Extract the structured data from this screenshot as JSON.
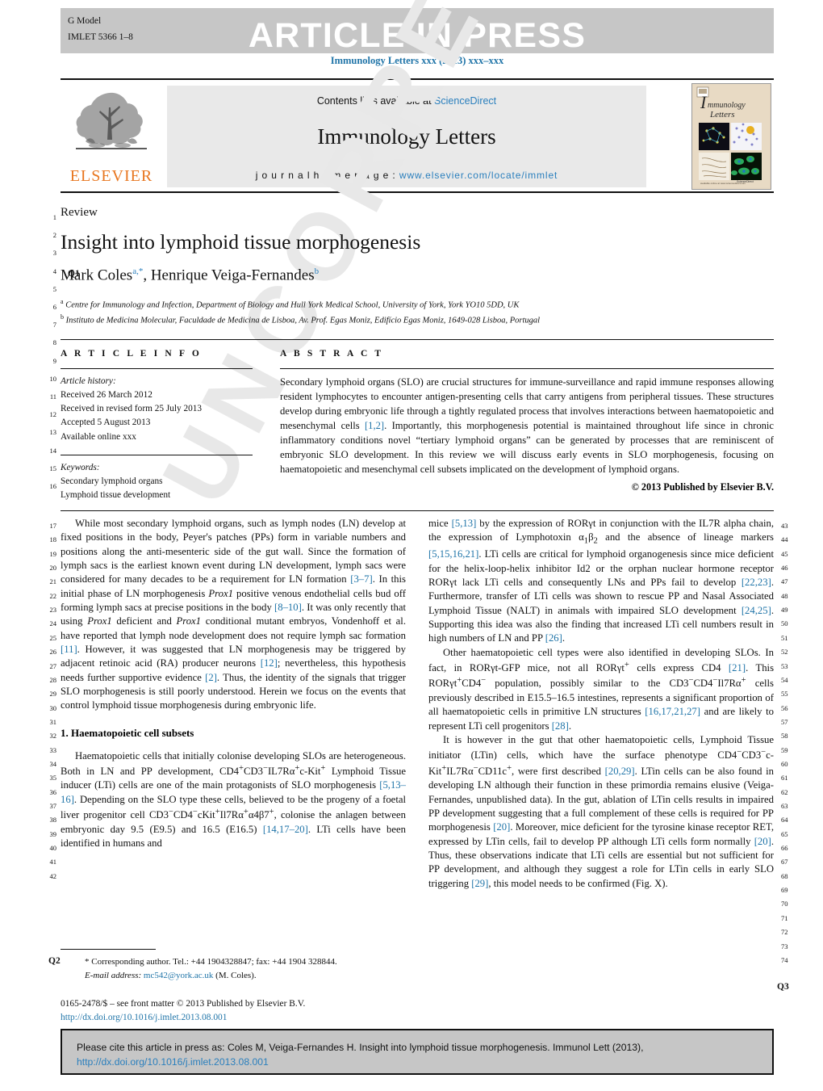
{
  "header": {
    "g_model_label": "G Model",
    "g_model_id": "IMLET 5366 1–8",
    "article_in_press": "ARTICLE IN PRESS",
    "journal_ref": "Immunology Letters xxx (2013) xxx–xxx"
  },
  "masthead": {
    "publisher": "ELSEVIER",
    "contents_prefix": "Contents lists available at ",
    "contents_link": "ScienceDirect",
    "journal_name": "Immunology Letters",
    "homepage_prefix": "j o u r n a l  h o m e p a g e :  ",
    "homepage_url": "www.elsevier.com/locate/immlet",
    "cover_title_line1": "Immunology",
    "cover_title_line2": "Letters"
  },
  "title_block": {
    "kicker": "Review",
    "title": "Insight into lymphoid tissue morphogenesis",
    "author1": "Mark Coles",
    "author1_sup": "a,*",
    "author_sep": ", ",
    "author2": "Henrique Veiga-Fernandes",
    "author2_sup": "b",
    "affiliation_a_sup": "a",
    "affiliation_a": "Centre for Immunology and Infection, Department of Biology and Hull York Medical School, University of York, York YO10 5DD, UK",
    "affiliation_b_sup": "b",
    "affiliation_b": "Instituto de Medicina Molecular, Faculdade de Medicina de Lisboa, Av. Prof. Egas Moniz, Edifício Egas Moniz, 1649-028 Lisboa, Portugal"
  },
  "article_info": {
    "heading": "A R T I C L E   I N F O",
    "history_label": "Article history:",
    "history": [
      "Received 26 March 2012",
      "Received in revised form 25 July 2013",
      "Accepted 5 August 2013",
      "Available online xxx"
    ],
    "keywords_label": "Keywords:",
    "keywords": [
      "Secondary lymphoid organs",
      "Lymphoid tissue development"
    ]
  },
  "abstract": {
    "heading": "A B S T R A C T",
    "paragraph_1": "Secondary lymphoid organs (SLO) are crucial structures for immune-surveillance and rapid immune responses allowing resident lymphocytes to encounter antigen-presenting cells that carry antigens from peripheral tissues. These structures develop during embryonic life through a tightly regulated process that involves interactions between haematopoietic and mesenchymal cells ",
    "ref_1": "[1,2]",
    "paragraph_2": ". Importantly, this morphogenesis potential is maintained throughout life since in chronic inflammatory conditions novel “tertiary lymphoid organs” can be generated by processes that are reminiscent of embryonic SLO development. In this review we will discuss early events in SLO morphogenesis, focusing on haematopoietic and mesenchymal cell subsets implicated on the development of lymphoid organs.",
    "copyright": "© 2013 Published by Elsevier B.V."
  },
  "body": {
    "left_column": {
      "para_1_a": "While most secondary lymphoid organs, such as lymph nodes (LN) develop at fixed positions in the body, Peyer's patches (PPs) form in variable numbers and positions along the anti-mesenteric side of the gut wall. Since the formation of lymph sacs is the earliest known event during LN development, lymph sacs were considered for many decades to be a requirement for LN formation ",
      "ref_3_7": "[3–7]",
      "para_1_b": ". In this initial phase of LN morphogenesis ",
      "italic_prox1_a": "Prox1",
      "para_1_c": " positive venous endothelial cells bud off forming lymph sacs at precise positions in the body ",
      "ref_8_10": "[8–10]",
      "para_1_d": ". It was only recently that using ",
      "italic_prox1_b": "Prox1",
      "para_1_e": " deficient and ",
      "italic_prox1_c": "Prox1",
      "para_1_f": " conditional mutant embryos, Vondenhoff et al. have reported that lymph node development does not require lymph sac formation ",
      "ref_11": "[11]",
      "para_1_g": ". However, it was suggested that LN morphogenesis may be triggered by adjacent retinoic acid (RA) producer neurons ",
      "ref_12": "[12]",
      "para_1_h": "; nevertheless, this hypothesis needs further supportive evidence ",
      "ref_2": "[2]",
      "para_1_i": ". Thus, the identity of the signals that trigger SLO morphogenesis is still poorly understood. Herein we focus on the events that control lymphoid tissue morphogenesis during embryonic life.",
      "section_heading": "1.  Haematopoietic cell subsets",
      "para_2_a": "Haematopoietic cells that initially colonise developing SLOs are heterogeneous. Both in LN and PP development, CD4",
      "sup_plus_1": "+",
      "para_2_b": "CD3",
      "sup_minus_1": "−",
      "para_2_c": "IL7Rα",
      "sup_plus_2": "+",
      "para_2_d": "c-Kit",
      "sup_plus_3": "+",
      "para_2_e": " Lymphoid Tissue inducer (LTi) cells are one of the main protagonists of SLO morphogenesis ",
      "ref_5_13_16": "[5,13–16]",
      "para_2_f": ". Depending on the SLO type these cells, believed to be the progeny of a foetal liver progenitor cell CD3",
      "sup_minus_2": "−",
      "para_2_g": "CD4",
      "sup_minus_3": "−",
      "para_2_h": "cKit",
      "sup_plus_4": "+",
      "para_2_i": "Il7Rα",
      "sup_plus_5": "+",
      "para_2_j": "α4β7",
      "sup_plus_6": "+",
      "para_2_k": ", colonise the anlagen between embryonic day 9.5 (E9.5) and 16.5 (E16.5) ",
      "ref_14_17_20": "[14,17–20]",
      "para_2_l": ". LTi cells have been identified in humans and"
    },
    "right_column": {
      "para_1_a": "mice ",
      "ref_5_13": "[5,13]",
      "para_1_b": " by the expression of RORγt in conjunction with the IL7R alpha chain, the expression of Lymphotoxin α",
      "sub_1": "1",
      "para_1_c": "β",
      "sub_2": "2",
      "para_1_d": " and the absence of lineage markers ",
      "ref_5_15_16_21": "[5,15,16,21]",
      "para_1_e": ". LTi cells are critical for lymphoid organogenesis since mice deficient for the helix-loop-helix inhibitor Id2 or the orphan nuclear hormone receptor RORγt lack LTi cells and consequently LNs and PPs fail to develop ",
      "ref_22_23": "[22,23]",
      "para_1_f": ". Furthermore, transfer of LTi cells was shown to rescue PP and Nasal Associated Lymphoid Tissue (NALT) in animals with impaired SLO development ",
      "ref_24_25": "[24,25]",
      "para_1_g": ". Supporting this idea was also the finding that increased LTi cell numbers result in high numbers of LN and PP ",
      "ref_26": "[26]",
      "para_1_h": ".",
      "para_2_a": "Other haematopoietic cell types were also identified in developing SLOs. In fact, in RORγt-GFP mice, not all RORγt",
      "sup_plus_1": "+",
      "para_2_b": " cells express CD4 ",
      "ref_21": "[21]",
      "para_2_c": ". This RORγt",
      "sup_plus_2": "+",
      "para_2_d": "CD4",
      "sup_minus_1": "−",
      "para_2_e": " population, possibly similar to the CD3",
      "sup_minus_2": "−",
      "para_2_f": "CD4",
      "sup_minus_3": "−",
      "para_2_g": "Il7Rα",
      "sup_plus_3": "+",
      "para_2_h": " cells previously described in E15.5–16.5 intestines, represents a significant proportion of all haematopoietic cells in primitive LN structures ",
      "ref_16_17_21_27": "[16,17,21,27]",
      "para_2_i": " and are likely to represent LTi cell progenitors ",
      "ref_28": "[28]",
      "para_2_j": ".",
      "para_3_a": "It is however in the gut that other haematopoietic cells, Lymphoid Tissue initiator (LTin) cells, which have the surface phenotype CD4",
      "sup_minus_4": "−",
      "para_3_b": "CD3",
      "sup_minus_5": "−",
      "para_3_c": "c-Kit",
      "sup_plus_4": "+",
      "para_3_d": "IL7Rα",
      "sup_minus_6": "−",
      "para_3_e": "CD11c",
      "sup_plus_5": "+",
      "para_3_f": ", were first described ",
      "ref_20_29": "[20,29]",
      "para_3_g": ". LTin cells can be also found in developing LN although their function in these primordia remains elusive (Veiga-Fernandes, unpublished data). In the gut, ablation of LTin cells results in impaired PP development suggesting that a full complement of these cells is required for PP morphogenesis ",
      "ref_20": "[20]",
      "para_3_h": ". Moreover, mice deficient for the tyrosine kinase receptor RET, expressed by LTin cells, fail to develop PP although LTi cells form normally ",
      "ref_20_b": "[20]",
      "para_3_i": ". Thus, these observations indicate that LTi cells are essential but not sufficient for PP development, and although they suggest a role for LTin cells in early SLO triggering ",
      "ref_29": "[29]",
      "para_3_j": ", this model needs to be confirmed (Fig. X)."
    }
  },
  "footnote": {
    "corresponding": "* Corresponding author. Tel.: +44 1904328847; fax: +44 1904 328844.",
    "email_label": "E-mail address:",
    "email": "mc542@york.ac.uk",
    "email_owner": "(M. Coles).",
    "front_matter": "0165-2478/$ – see front matter © 2013 Published by Elsevier B.V.",
    "doi": "http://dx.doi.org/10.1016/j.imlet.2013.08.001"
  },
  "query_marks": {
    "q1": "Q1",
    "q2": "Q2",
    "q3": "Q3"
  },
  "cite_box": {
    "text": "Please cite this article in press as: Coles M, Veiga-Fernandes H. Insight into lymphoid tissue morphogenesis. Immunol Lett (2013),",
    "doi": "http://dx.doi.org/10.1016/j.imlet.2013.08.001"
  },
  "watermark": {
    "text": "UNCORRECTED PROOF"
  },
  "line_numbers": {
    "left": [
      "1",
      "2",
      "3",
      "4",
      "5",
      "6",
      "7",
      "8",
      "9",
      "10",
      "11",
      "12",
      "13",
      "14",
      "15",
      "16"
    ],
    "left_body": [
      "17",
      "18",
      "19",
      "20",
      "21",
      "22",
      "23",
      "24",
      "25",
      "26",
      "27",
      "28",
      "29",
      "30",
      "31",
      "32",
      "33",
      "34",
      "35",
      "36",
      "37",
      "38",
      "39",
      "40",
      "41",
      "42"
    ],
    "right_body": [
      "43",
      "44",
      "45",
      "46",
      "47",
      "48",
      "49",
      "50",
      "51",
      "52",
      "53",
      "54",
      "55",
      "56",
      "57",
      "58",
      "59",
      "60",
      "61",
      "62",
      "63",
      "64",
      "65",
      "66",
      "67",
      "68",
      "69",
      "70",
      "71",
      "72",
      "73",
      "74"
    ]
  },
  "colors": {
    "link": "#1f74a8",
    "link_sans": "#2a7fbd",
    "elsevier_orange": "#e8761f",
    "strip_grey": "#c6c6c6",
    "box_grey": "#e9e9e9"
  }
}
